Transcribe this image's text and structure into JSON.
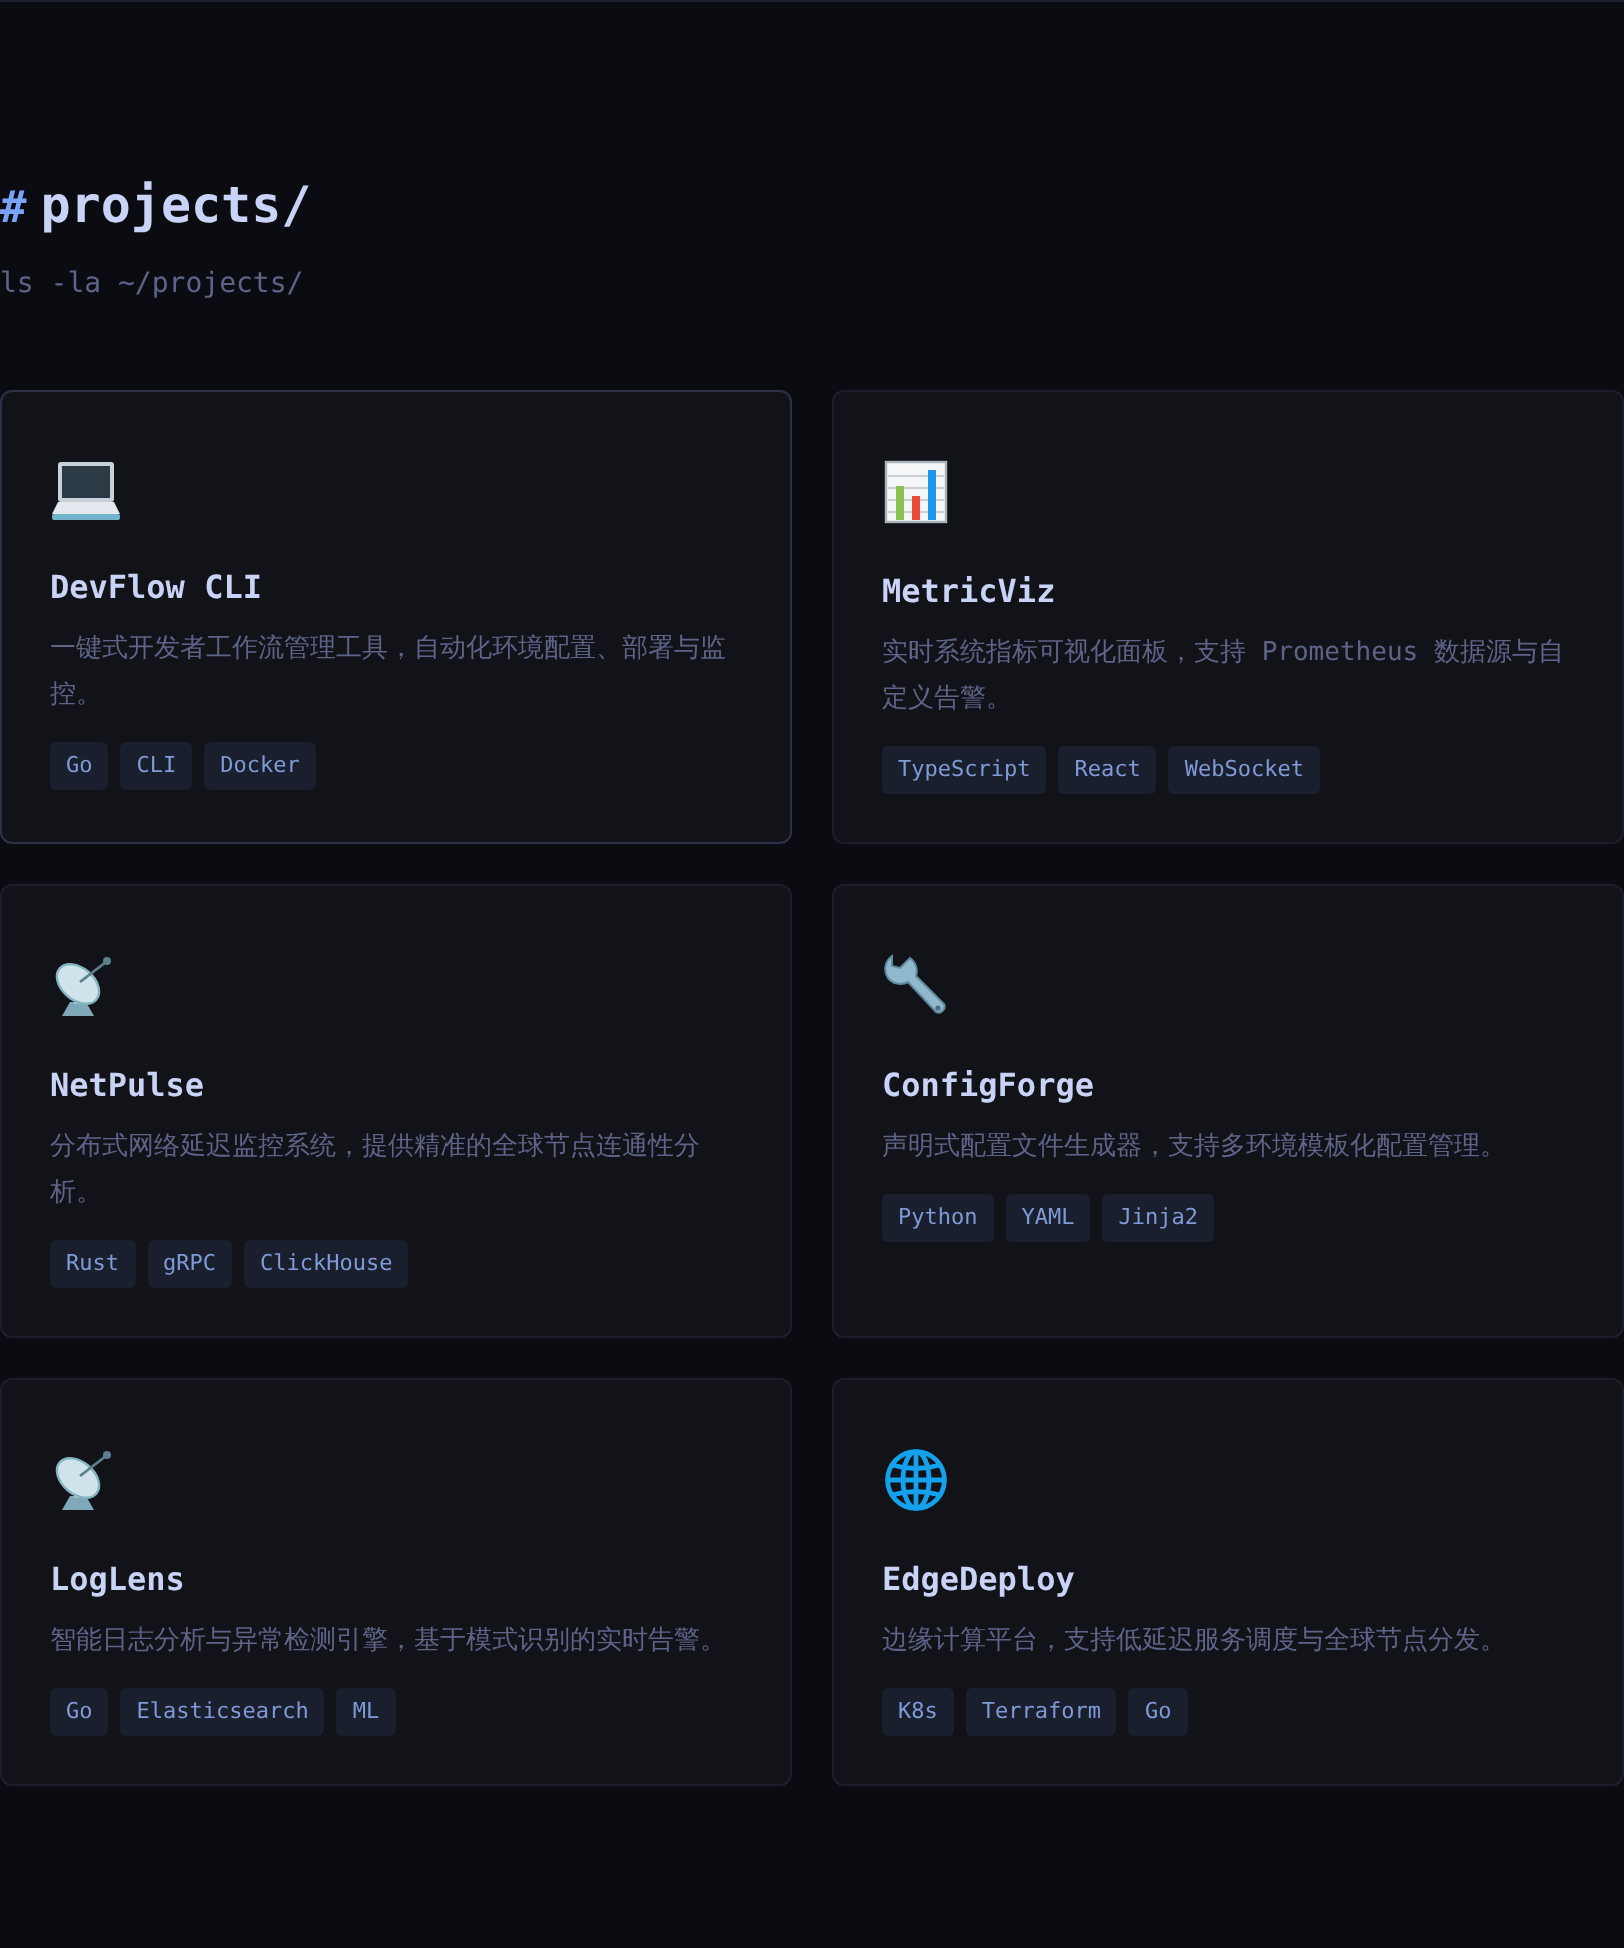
{
  "header": {
    "prefix": "#",
    "title": "projects/",
    "command": "ls -la ~/projects/"
  },
  "projects": [
    {
      "kind": "laptop",
      "hovered": true,
      "name": "DevFlow CLI",
      "description": "一键式开发者工作流管理工具，自动化环境配置、部署与监控。",
      "tags": [
        "Go",
        "CLI",
        "Docker"
      ]
    },
    {
      "kind": "chart",
      "hovered": false,
      "name": "MetricViz",
      "description": "实时系统指标可视化面板，支持 Prometheus 数据源与自定义告警。",
      "tags": [
        "TypeScript",
        "React",
        "WebSocket"
      ]
    },
    {
      "kind": "dish",
      "hovered": false,
      "name": "NetPulse",
      "description": "分布式网络延迟监控系统，提供精准的全球节点连通性分析。",
      "tags": [
        "Rust",
        "gRPC",
        "ClickHouse"
      ]
    },
    {
      "kind": "wrench",
      "hovered": false,
      "name": "ConfigForge",
      "description": "声明式配置文件生成器，支持多环境模板化配置管理。",
      "tags": [
        "Python",
        "YAML",
        "Jinja2"
      ]
    },
    {
      "kind": "dish",
      "hovered": false,
      "name": "LogLens",
      "description": "智能日志分析与异常检测引擎，基于模式识别的实时告警。",
      "tags": [
        "Go",
        "Elasticsearch",
        "ML"
      ]
    },
    {
      "kind": "globe",
      "hovered": false,
      "name": "EdgeDeploy",
      "description": "边缘计算平台，支持低延迟服务调度与全球节点分发。",
      "tags": [
        "K8s",
        "Terraform",
        "Go"
      ]
    }
  ]
}
